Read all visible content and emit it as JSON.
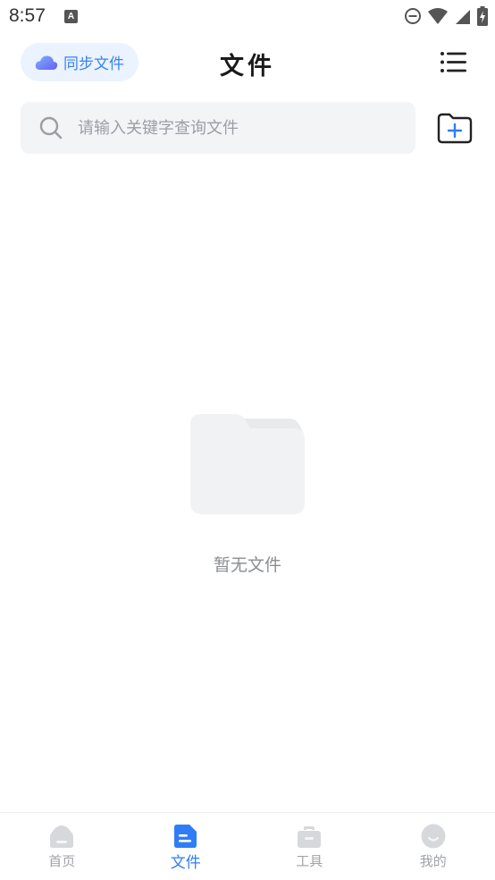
{
  "status_bar": {
    "time": "8:57",
    "notification_icon": "a-notification-icon",
    "dnd_icon": "do-not-disturb-icon",
    "wifi_icon": "wifi-icon",
    "signal_icon": "signal-icon",
    "battery_icon": "battery-charging-icon"
  },
  "header": {
    "sync_label": "同步文件",
    "title": "文件",
    "menu_icon": "list-menu-icon"
  },
  "search": {
    "placeholder": "请输入关键字查询文件",
    "value": "",
    "icon": "search-icon"
  },
  "actions": {
    "new_folder_icon": "new-folder-icon"
  },
  "empty_state": {
    "text": "暂无文件",
    "icon": "empty-folder-icon"
  },
  "bottom_nav": {
    "active_index": 1,
    "accent_color": "#2f7df6",
    "items": [
      {
        "label": "首页",
        "icon": "home-icon"
      },
      {
        "label": "文件",
        "icon": "file-icon"
      },
      {
        "label": "工具",
        "icon": "toolbox-icon"
      },
      {
        "label": "我的",
        "icon": "profile-icon"
      }
    ]
  }
}
